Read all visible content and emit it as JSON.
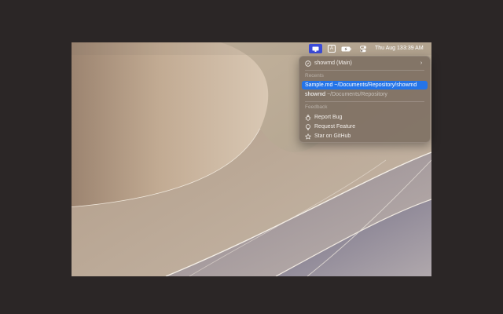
{
  "menubar": {
    "app_icon": "showmd-app-icon",
    "input_badge": "A",
    "date": "Thu Aug 13",
    "time": "3:39 AM"
  },
  "menu": {
    "main_item": {
      "label": "showmd (Main)",
      "icon": "compass-icon"
    },
    "recents_heading": "Recents",
    "recents": [
      {
        "name": "Sample.md",
        "path": "~/Documents/Repository/showmd",
        "selected": true
      },
      {
        "name": "showmd",
        "path": "~/Documents/Repository",
        "selected": false
      }
    ],
    "feedback_heading": "Feedback",
    "feedback": [
      {
        "label": "Report Bug",
        "icon": "bug-icon"
      },
      {
        "label": "Request Feature",
        "icon": "lightbulb-icon"
      },
      {
        "label": "Star on GitHub",
        "icon": "star-icon"
      }
    ]
  },
  "colors": {
    "page_background": "#2b2626",
    "selection": "#2474e8",
    "menu_background": "#7a6c60"
  }
}
